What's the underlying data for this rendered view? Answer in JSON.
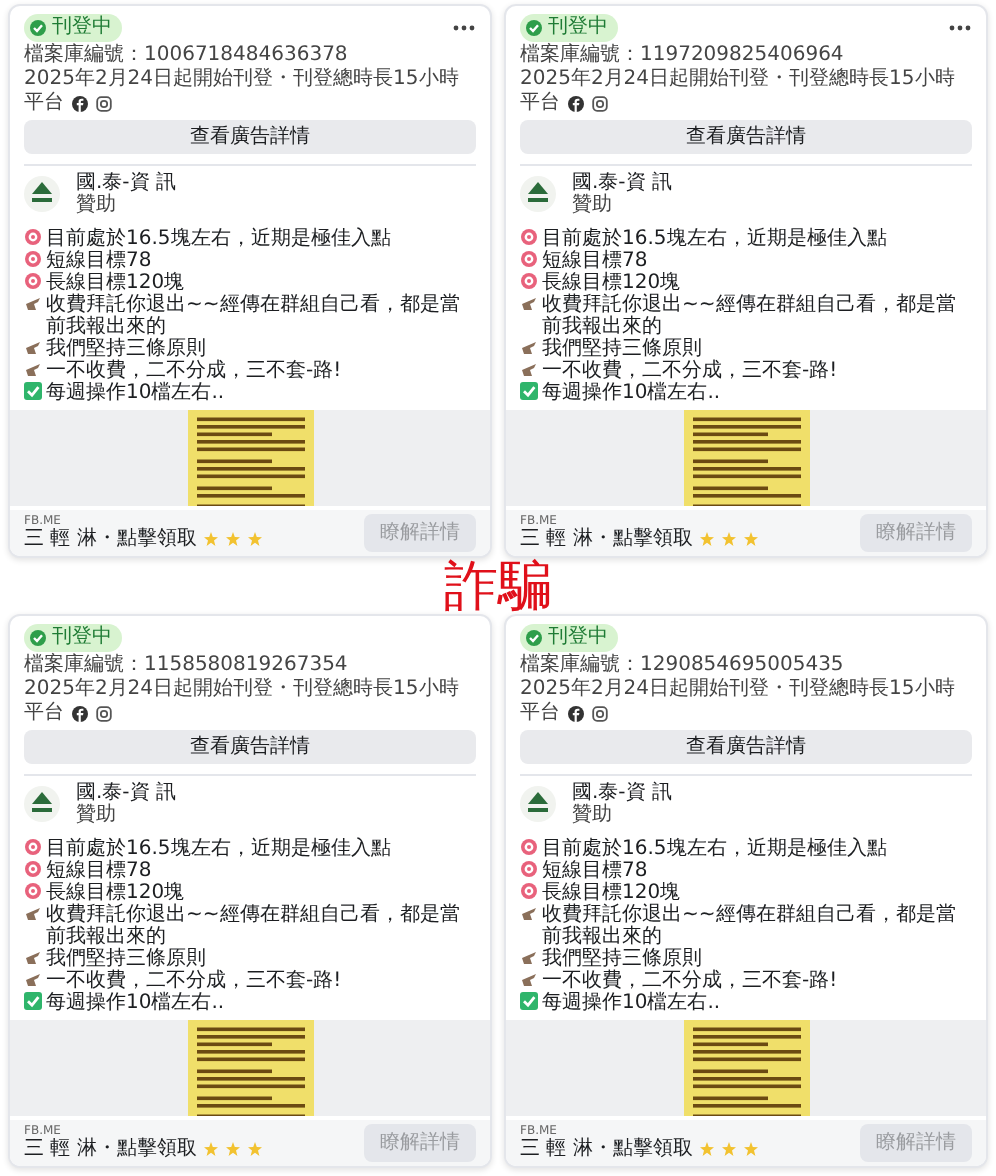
{
  "overlay_label": "詐騙",
  "cards": [
    {
      "status": "刊登中",
      "menu": true,
      "library_id": "檔案庫編號：1006718484636378",
      "date": "2025年2月24日起開始刊登・刊登總時長15小時",
      "platform_label": "平台",
      "details_button": "查看廣告詳情",
      "advertiser": "國.泰-資 訊",
      "sponsored": "贊助",
      "body": [
        {
          "kind": "target",
          "text": "目前處於16.5塊左右，近期是極佳入點"
        },
        {
          "kind": "target",
          "text": "短線目標78"
        },
        {
          "kind": "target",
          "text": "長線目標120塊"
        },
        {
          "kind": "hand",
          "text": "收費拜託你退出~~經傳在群組自己看，都是當前我報出來的"
        },
        {
          "kind": "hand",
          "text": "我們堅持三條原則"
        },
        {
          "kind": "hand",
          "text": "一不收費，二不分成，三不套-路!"
        },
        {
          "kind": "check",
          "text": "每週操作10檔左右.."
        }
      ],
      "link_caption": "FB.ME",
      "link_title": "三 輕 淋・點擊領取",
      "cta": {
        "label": "瞭解詳情",
        "disabled": true
      }
    },
    {
      "status": "刊登中",
      "menu": true,
      "library_id": "檔案庫編號：1197209825406964",
      "date": "2025年2月24日起開始刊登・刊登總時長15小時",
      "platform_label": "平台",
      "details_button": "查看廣告詳情",
      "advertiser": "國.泰-資 訊",
      "sponsored": "贊助",
      "body": [
        {
          "kind": "target",
          "text": "目前處於16.5塊左右，近期是極佳入點"
        },
        {
          "kind": "target",
          "text": "短線目標78"
        },
        {
          "kind": "target",
          "text": "長線目標120塊"
        },
        {
          "kind": "hand",
          "text": "收費拜託你退出~~經傳在群組自己看，都是當前我報出來的"
        },
        {
          "kind": "hand",
          "text": "我們堅持三條原則"
        },
        {
          "kind": "hand",
          "text": "一不收費，二不分成，三不套-路!"
        },
        {
          "kind": "check",
          "text": "每週操作10檔左右.."
        }
      ],
      "link_caption": "FB.ME",
      "link_title": "三 輕 淋・點擊領取",
      "cta": {
        "label": "瞭解詳情",
        "disabled": true
      }
    },
    {
      "status": "刊登中",
      "menu": false,
      "library_id": "檔案庫編號：1158580819267354",
      "date": "2025年2月24日起開始刊登・刊登總時長15小時",
      "platform_label": "平台",
      "details_button": "查看廣告詳情",
      "advertiser": "國.泰-資 訊",
      "sponsored": "贊助",
      "body": [
        {
          "kind": "target",
          "text": "目前處於16.5塊左右，近期是極佳入點"
        },
        {
          "kind": "target",
          "text": "短線目標78"
        },
        {
          "kind": "target",
          "text": "長線目標120塊"
        },
        {
          "kind": "hand",
          "text": "收費拜託你退出~~經傳在群組自己看，都是當前我報出來的"
        },
        {
          "kind": "hand",
          "text": "我們堅持三條原則"
        },
        {
          "kind": "hand",
          "text": "一不收費，二不分成，三不套-路!"
        },
        {
          "kind": "check",
          "text": "每週操作10檔左右.."
        }
      ],
      "link_caption": "FB.ME",
      "link_title": "三 輕 淋・點擊領取",
      "cta": {
        "label": "瞭解詳情",
        "disabled": true
      }
    },
    {
      "status": "刊登中",
      "menu": false,
      "library_id": "檔案庫編號：1290854695005435",
      "date": "2025年2月24日起開始刊登・刊登總時長15小時",
      "platform_label": "平台",
      "details_button": "查看廣告詳情",
      "advertiser": "國.泰-資 訊",
      "sponsored": "贊助",
      "body": [
        {
          "kind": "target",
          "text": "目前處於16.5塊左右，近期是極佳入點"
        },
        {
          "kind": "target",
          "text": "短線目標78"
        },
        {
          "kind": "target",
          "text": "長線目標120塊"
        },
        {
          "kind": "hand",
          "text": "收費拜託你退出~~經傳在群組自己看，都是當前我報出來的"
        },
        {
          "kind": "hand",
          "text": "我們堅持三條原則"
        },
        {
          "kind": "hand",
          "text": "一不收費，二不分成，三不套-路!"
        },
        {
          "kind": "check",
          "text": "每週操作10檔左右.."
        }
      ],
      "link_caption": "FB.ME",
      "link_title": "三 輕 淋・點擊領取",
      "cta": {
        "label": "瞭解詳情",
        "disabled": true
      }
    }
  ]
}
